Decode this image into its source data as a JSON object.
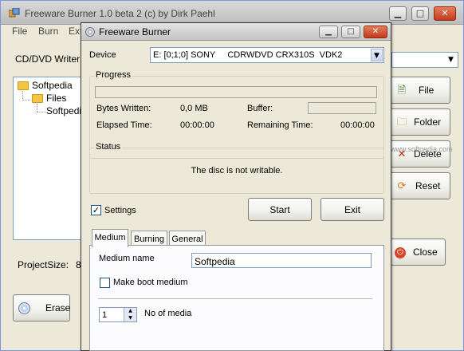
{
  "back_window": {
    "title": "Freeware Burner 1.0 beta 2 (c) by Dirk Paehl",
    "menu": [
      "File",
      "Burn",
      "Ext"
    ],
    "writer_label": "CD/DVD Writer:",
    "tree": {
      "root": "Softpedia",
      "child_folder": "Files",
      "child_item": "Softpedia"
    },
    "project_size_label": "ProjectSize:",
    "project_size_value": "8",
    "buttons": {
      "file": "File",
      "folder": "Folder",
      "delete": "Delete",
      "reset": "Reset",
      "close": "Close",
      "erase": "Erase"
    },
    "watermark": "www.softpedia.com"
  },
  "dialog": {
    "title": "Freeware Burner",
    "device_label": "Device",
    "device_value": "E: [0;1;0] SONY     CDRWDVD CRX310S  VDK2",
    "progress": {
      "group_label": "Progress",
      "bar_fraction": 0,
      "bytes_written_label": "Bytes Written:",
      "bytes_written_value": "0,0 MB",
      "buffer_label": "Buffer:",
      "buffer_fraction": 0,
      "elapsed_label": "Elapsed Time:",
      "elapsed_value": "00:00:00",
      "remaining_label": "Remaining Time:",
      "remaining_value": "00:00:00"
    },
    "status": {
      "group_label": "Status",
      "message": "The disc is not writable."
    },
    "settings_label": "Settings",
    "settings_checked": true,
    "start_label": "Start",
    "exit_label": "Exit",
    "tabs": [
      "Medium",
      "Burning",
      "General"
    ],
    "active_tab": "Medium",
    "medium": {
      "name_label": "Medium name",
      "name_value": "Softpedia",
      "boot_label": "Make boot medium",
      "boot_checked": false,
      "count_value": "1",
      "count_label": "No of media"
    }
  }
}
